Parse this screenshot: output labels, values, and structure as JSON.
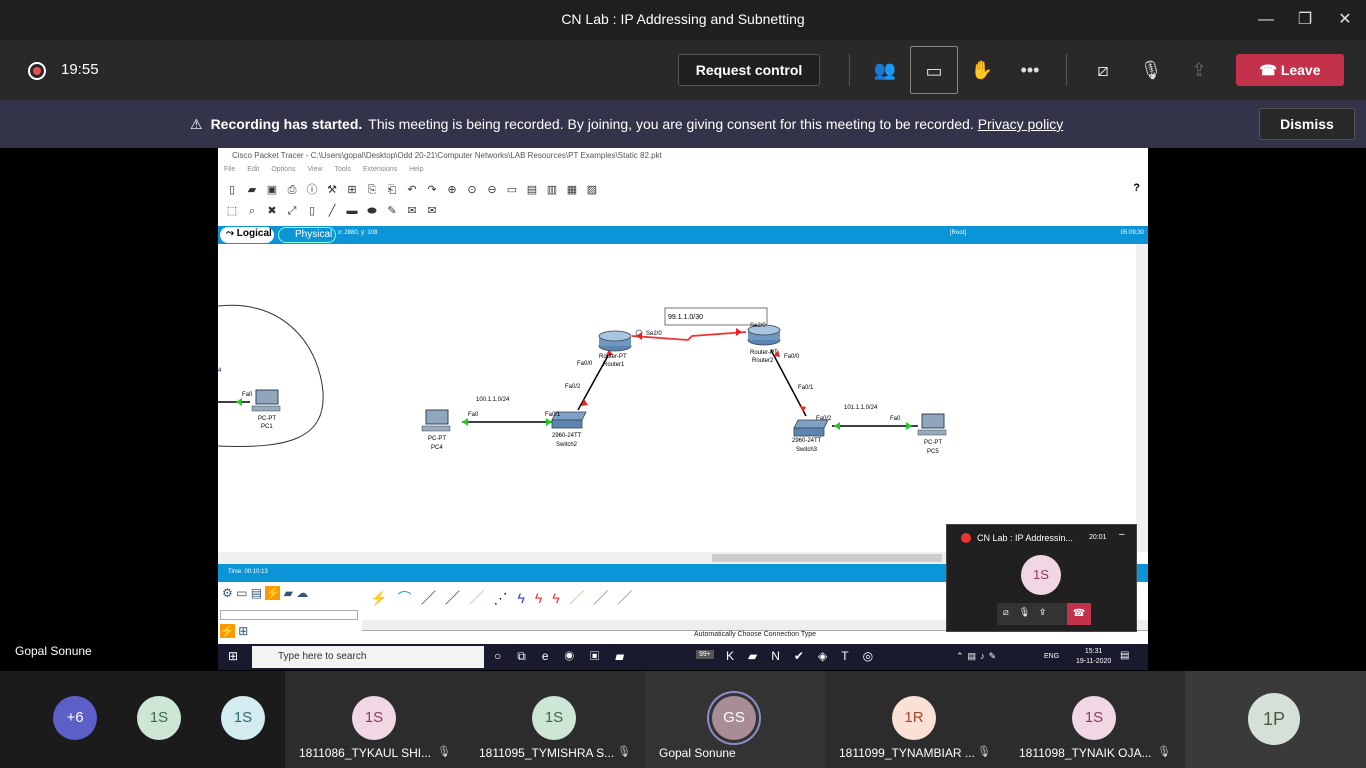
{
  "window": {
    "title": "CN Lab : IP Addressing and Subnetting"
  },
  "meeting": {
    "timer": "19:55",
    "request_control": "Request control",
    "leave": "Leave"
  },
  "banner": {
    "bold": "Recording has started.",
    "text": "This meeting is being recorded. By joining, you are giving consent for this meeting to be recorded.",
    "link": "Privacy policy",
    "dismiss": "Dismiss"
  },
  "pt": {
    "title": "Cisco Packet Tracer - C:\\Users\\gopal\\Desktop\\Odd 20-21\\Computer Networks\\LAB Resources\\PT Examples\\Static 82.pkt",
    "menu": [
      "File",
      "Edit",
      "Options",
      "View",
      "Tools",
      "Extensions",
      "Help"
    ],
    "logical": "Logical",
    "physical": "Physical",
    "coords": "x: 2880, y: 108",
    "root": "[Root]",
    "clock": "05:09:30",
    "time": "Time: 00:10:13",
    "auto_conn": "Automatically Choose Connection Type",
    "devices": {
      "pc1_type": "PC-PT",
      "pc1": "PC1",
      "pc4_type": "PC-PT",
      "pc4": "PC4",
      "pc5_type": "PC-PT",
      "pc5": "PC5",
      "sw2_type": "2960-24TT",
      "sw2": "Switch2",
      "sw3_type": "2960-24TT",
      "sw3": "Switch3",
      "r1_type": "Router-PT",
      "r1": "Router1",
      "r2_type": "Router-PT",
      "r2": "Router2"
    },
    "labels": {
      "net1": "100.1.1.0/24",
      "net2": "101.1.1.0/24",
      "serial_net": "99.1.1.0/30",
      "fa0_pc1": "Fa0",
      "fa0_pc4": "Fa0",
      "fa01_sw2": "Fa0/1",
      "fa02_sw2": "Fa0/2",
      "fa00_r1": "Fa0/0",
      "se20_r1": "Se2/0",
      "se20_r2": "Se2/0",
      "fa00_r2": "Fa0/0",
      "fa01_sw3": "Fa0/1",
      "fa02_sw3": "Fa0/2",
      "fa0_pc5": "Fa0",
      "left_num": "4"
    }
  },
  "taskbar": {
    "search": "Type here to search",
    "lang": "ENG",
    "time": "15:31",
    "date": "19-11-2020",
    "badge": "99+"
  },
  "mini": {
    "title": "CN Lab : IP Addressin...",
    "time": "20:01",
    "avatar": "1S"
  },
  "speaker": "Gopal Sonune",
  "participants": [
    {
      "initials": "+6"
    },
    {
      "initials": "1S"
    },
    {
      "initials": "1S"
    },
    {
      "initials": "1S",
      "name": "1811086_TYKAUL SHI..."
    },
    {
      "initials": "1S",
      "name": "1811095_TYMISHRA S..."
    },
    {
      "initials": "GS",
      "name": "Gopal Sonune"
    },
    {
      "initials": "1R",
      "name": "1811099_TYNAMBIAR ..."
    },
    {
      "initials": "1S",
      "name": "1811098_TYNAIK OJA..."
    },
    {
      "initials": "1P"
    }
  ]
}
